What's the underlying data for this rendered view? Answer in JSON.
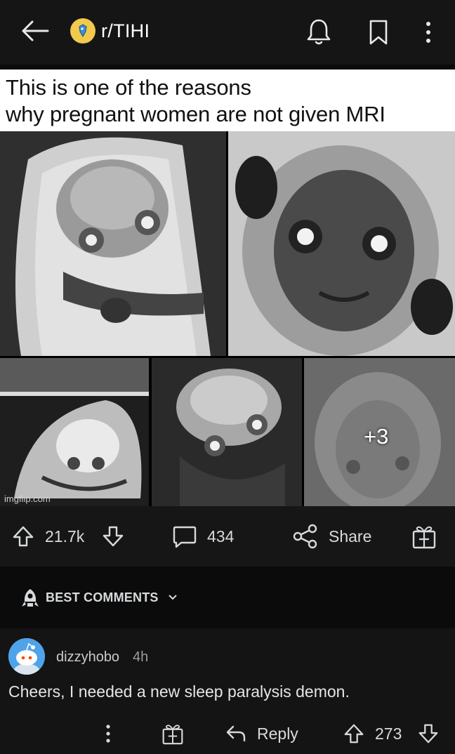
{
  "header": {
    "subreddit": "r/TIHI"
  },
  "post": {
    "caption_line1": "This is one of the reasons",
    "caption_line2": "why pregnant women are not given MRI",
    "more_images": "+3",
    "watermark": "imgflip.com"
  },
  "actions": {
    "upvotes": "21.7k",
    "comments": "434",
    "share_label": "Share"
  },
  "sort": {
    "label": "BEST COMMENTS"
  },
  "comment": {
    "username": "dizzyhobo",
    "time": "4h",
    "body": "Cheers, I needed a new sleep paralysis demon.",
    "reply_label": "Reply",
    "score": "273"
  },
  "colors": {
    "background": "#0b0b0b",
    "header": "#151515",
    "subreddit_icon": "#f2c94c",
    "avatar": "#4fa3e8",
    "text": "#d7dadc"
  }
}
